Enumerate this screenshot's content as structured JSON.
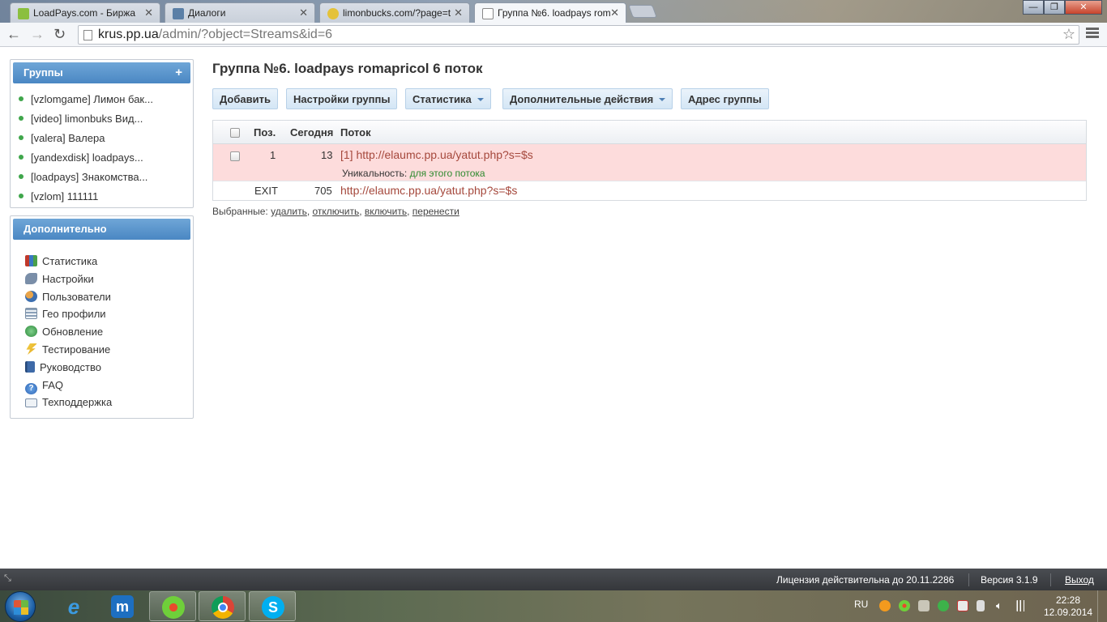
{
  "browser": {
    "tabs": [
      {
        "title": "LoadPays.com - Биржа",
        "icon_color": "#8bbf3f"
      },
      {
        "title": "Диалоги",
        "icon_color": "#5b7fa6"
      },
      {
        "title": "limonbucks.com/?page=t",
        "icon_color": "#e4c23a"
      },
      {
        "title": "Группа №6. loadpays rom",
        "icon_color": "#ffffff"
      }
    ],
    "url_host": "krus.pp.ua",
    "url_path": "/admin/?object=Streams&id=6"
  },
  "sidebar": {
    "groups_title": "Группы",
    "groups_add": "+",
    "groups": [
      "[vzlomgame] Лимон бак...",
      "[video] limonbuks Вид...",
      "[valera] Валера",
      "[yandexdisk] loadpays...",
      "[loadpays] Знакомства...",
      "[vzlom] 111111"
    ],
    "extra_title": "Дополнительно",
    "extra": [
      {
        "label": "Статистика",
        "icon": "bar-chart-icon",
        "color": "#c0392b"
      },
      {
        "label": "Настройки",
        "icon": "wrench-icon",
        "color": "#7a8ea8"
      },
      {
        "label": "Пользователи",
        "icon": "users-icon",
        "color": "#d08a2d"
      },
      {
        "label": "Гео профили",
        "icon": "table-icon",
        "color": "#8aa0b8"
      },
      {
        "label": "Обновление",
        "icon": "globe-icon",
        "color": "#3b9b4a"
      },
      {
        "label": "Тестирование",
        "icon": "lightning-icon",
        "color": "#e2b21c"
      },
      {
        "label": "Руководство",
        "icon": "book-icon",
        "color": "#3e6aa8"
      },
      {
        "label": "FAQ",
        "icon": "help-icon",
        "color": "#3b76c4"
      },
      {
        "label": "Техподдержка",
        "icon": "envelope-icon",
        "color": "#7a8ea8"
      }
    ]
  },
  "main": {
    "title": "Группа №6. loadpays romapricol 6 поток",
    "buttons": {
      "add": "Добавить",
      "group_settings": "Настройки группы",
      "statistics": "Статистика",
      "more_actions": "Дополнительные действия",
      "group_address": "Адрес группы"
    },
    "table": {
      "headers": {
        "pos": "Поз.",
        "today": "Сегодня",
        "stream": "Поток"
      },
      "rows": [
        {
          "pos": "1",
          "today": "13",
          "stream": "[1] http://elaumc.pp.ua/yatut.php?s=$s",
          "uniq_label": "Уникальность:",
          "uniq_value": "для этого потока"
        },
        {
          "pos": "EXIT",
          "today": "705",
          "stream": "http://elaumc.pp.ua/yatut.php?s=$s"
        }
      ]
    },
    "selected": {
      "label": "Выбранные:",
      "delete": "удалить",
      "disable": "отключить",
      "enable": "включить",
      "move": "перенести"
    }
  },
  "statusbar": {
    "license": "Лицензия действительна до 20.11.2286",
    "version": "Версия 3.1.9",
    "exit": "Выход"
  },
  "taskbar": {
    "lang": "RU",
    "time": "22:28",
    "date": "12.09.2014"
  },
  "colors": {
    "accent_blue": "#4a87c3",
    "row_highlight": "#fddcdc",
    "link_red": "#a5483c",
    "status_green": "#2f8a2f"
  }
}
